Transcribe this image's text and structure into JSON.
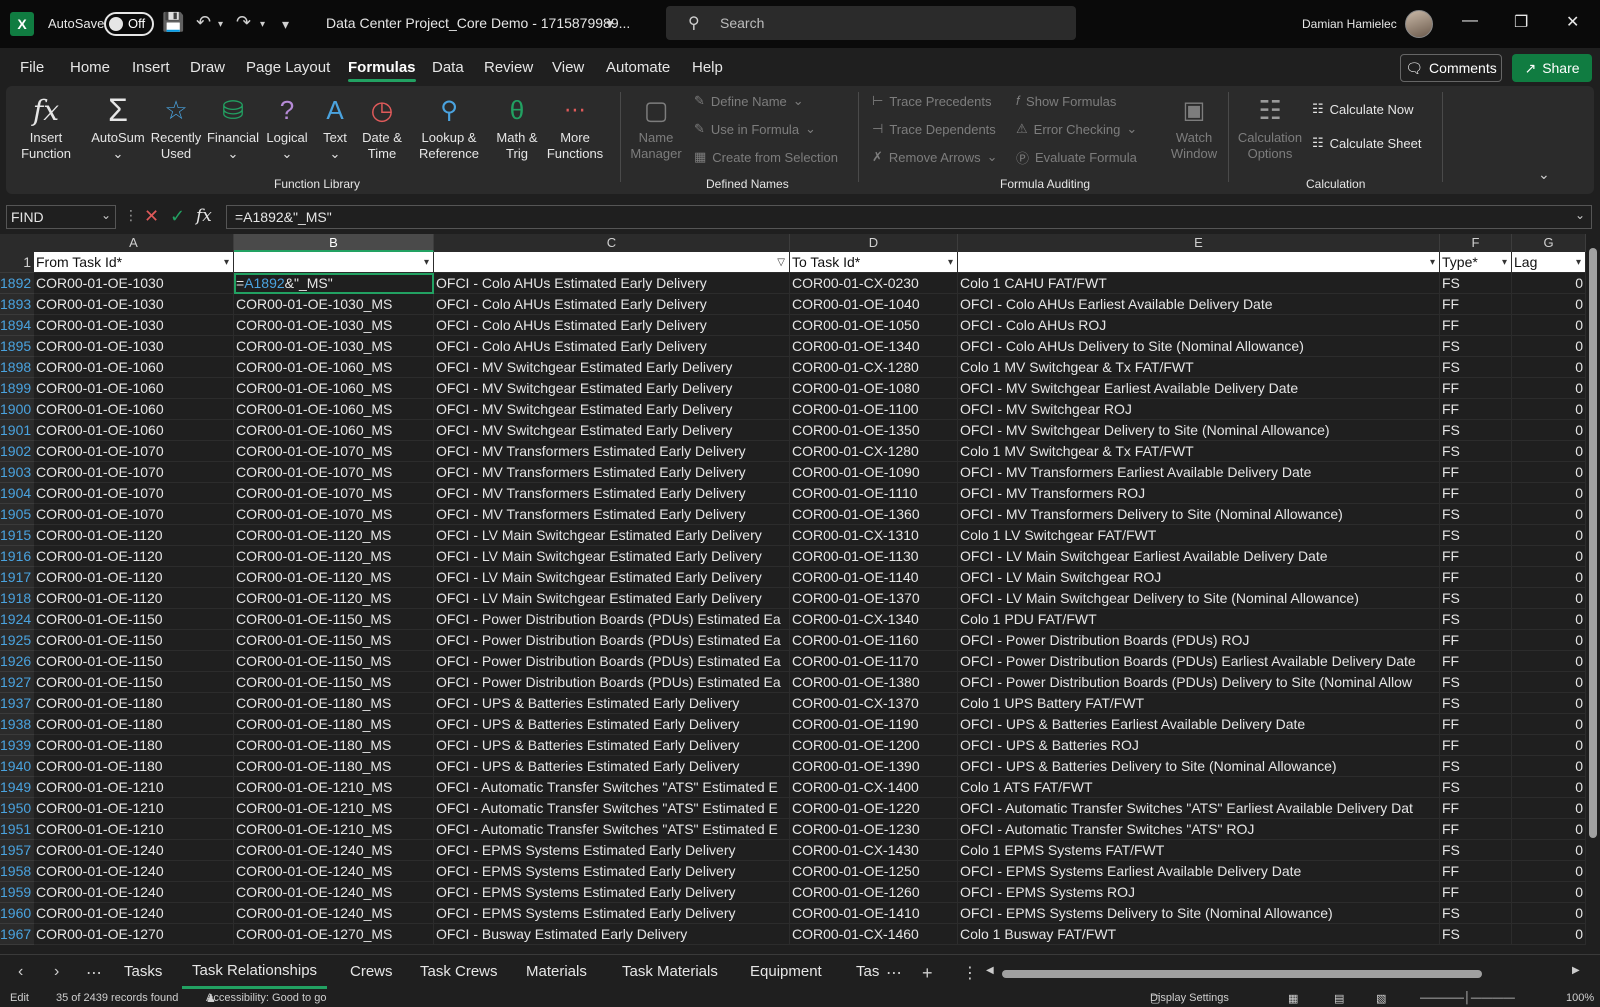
{
  "titlebar": {
    "autosave_label": "AutoSave",
    "autosave_state": "Off",
    "doc_title": "Data Center Project_Core Demo - 1715879989...",
    "search_placeholder": "Search",
    "user_name": "Damian Hamielec"
  },
  "menu": {
    "tabs": [
      "File",
      "Home",
      "Insert",
      "Draw",
      "Page Layout",
      "Formulas",
      "Data",
      "Review",
      "View",
      "Automate",
      "Help"
    ],
    "active": "Formulas",
    "comments": "Comments",
    "share": "Share"
  },
  "ribbon": {
    "insert_function": [
      "Insert",
      "Function"
    ],
    "autosum": "AutoSum",
    "recently_used": [
      "Recently",
      "Used"
    ],
    "financial": "Financial",
    "logical": "Logical",
    "text": "Text",
    "date_time": [
      "Date &",
      "Time"
    ],
    "lookup": [
      "Lookup &",
      "Reference"
    ],
    "math_trig": [
      "Math &",
      "Trig"
    ],
    "more_functions": [
      "More",
      "Functions"
    ],
    "function_library": "Function Library",
    "name_manager": [
      "Name",
      "Manager"
    ],
    "define_name": "Define Name",
    "use_in_formula": "Use in Formula",
    "create_from_selection": "Create from Selection",
    "defined_names": "Defined Names",
    "trace_precedents": "Trace Precedents",
    "trace_dependents": "Trace Dependents",
    "remove_arrows": "Remove Arrows",
    "show_formulas": "Show Formulas",
    "error_checking": "Error Checking",
    "evaluate_formula": "Evaluate Formula",
    "watch_window": [
      "Watch",
      "Window"
    ],
    "formula_auditing": "Formula Auditing",
    "calc_options": [
      "Calculation",
      "Options"
    ],
    "calculate_now": "Calculate Now",
    "calculate_sheet": "Calculate Sheet",
    "calculation": "Calculation"
  },
  "formula_bar": {
    "name_box": "FIND",
    "formula": "=A1892&\"_MS\"",
    "fx": "fx"
  },
  "grid": {
    "columns": [
      "A",
      "B",
      "C",
      "D",
      "E",
      "F",
      "G"
    ],
    "header_row_num": "1",
    "headers": [
      "From Task Id*",
      "",
      "",
      "To Task Id*",
      "",
      "Type*",
      "Lag"
    ],
    "active_cell_ref": "A1892",
    "active_cell_suffix": "&\"_MS\"",
    "rows": [
      [
        "1892",
        "COR00-01-OE-1030",
        "",
        "OFCI - Colo AHUs Estimated Early Delivery",
        "COR00-01-CX-0230",
        "Colo 1 CAHU FAT/FWT",
        "FS",
        "0"
      ],
      [
        "1893",
        "COR00-01-OE-1030",
        "COR00-01-OE-1030_MS",
        "OFCI - Colo AHUs Estimated Early Delivery",
        "COR00-01-OE-1040",
        "OFCI - Colo AHUs Earliest Available Delivery Date",
        "FF",
        "0"
      ],
      [
        "1894",
        "COR00-01-OE-1030",
        "COR00-01-OE-1030_MS",
        "OFCI - Colo AHUs Estimated Early Delivery",
        "COR00-01-OE-1050",
        "OFCI - Colo AHUs ROJ",
        "FF",
        "0"
      ],
      [
        "1895",
        "COR00-01-OE-1030",
        "COR00-01-OE-1030_MS",
        "OFCI - Colo AHUs Estimated Early Delivery",
        "COR00-01-OE-1340",
        "OFCI - Colo AHUs Delivery to Site (Nominal Allowance)",
        "FS",
        "0"
      ],
      [
        "1898",
        "COR00-01-OE-1060",
        "COR00-01-OE-1060_MS",
        "OFCI - MV Switchgear Estimated Early Delivery",
        "COR00-01-CX-1280",
        "Colo 1 MV Switchgear & Tx FAT/FWT",
        "FS",
        "0"
      ],
      [
        "1899",
        "COR00-01-OE-1060",
        "COR00-01-OE-1060_MS",
        "OFCI - MV Switchgear Estimated Early Delivery",
        "COR00-01-OE-1080",
        "OFCI - MV Switchgear Earliest Available Delivery Date",
        "FF",
        "0"
      ],
      [
        "1900",
        "COR00-01-OE-1060",
        "COR00-01-OE-1060_MS",
        "OFCI - MV Switchgear Estimated Early Delivery",
        "COR00-01-OE-1100",
        "OFCI - MV Switchgear ROJ",
        "FF",
        "0"
      ],
      [
        "1901",
        "COR00-01-OE-1060",
        "COR00-01-OE-1060_MS",
        "OFCI - MV Switchgear Estimated Early Delivery",
        "COR00-01-OE-1350",
        "OFCI - MV Switchgear Delivery to Site (Nominal Allowance)",
        "FS",
        "0"
      ],
      [
        "1902",
        "COR00-01-OE-1070",
        "COR00-01-OE-1070_MS",
        "OFCI - MV Transformers Estimated Early Delivery",
        "COR00-01-CX-1280",
        "Colo 1 MV Switchgear & Tx FAT/FWT",
        "FS",
        "0"
      ],
      [
        "1903",
        "COR00-01-OE-1070",
        "COR00-01-OE-1070_MS",
        "OFCI - MV Transformers Estimated Early Delivery",
        "COR00-01-OE-1090",
        "OFCI - MV Transformers Earliest Available Delivery Date",
        "FF",
        "0"
      ],
      [
        "1904",
        "COR00-01-OE-1070",
        "COR00-01-OE-1070_MS",
        "OFCI - MV Transformers Estimated Early Delivery",
        "COR00-01-OE-1110",
        "OFCI - MV Transformers ROJ",
        "FF",
        "0"
      ],
      [
        "1905",
        "COR00-01-OE-1070",
        "COR00-01-OE-1070_MS",
        "OFCI - MV Transformers Estimated Early Delivery",
        "COR00-01-OE-1360",
        "OFCI - MV Transformers Delivery to Site (Nominal Allowance)",
        "FS",
        "0"
      ],
      [
        "1915",
        "COR00-01-OE-1120",
        "COR00-01-OE-1120_MS",
        "OFCI - LV Main Switchgear Estimated Early Delivery",
        "COR00-01-CX-1310",
        "Colo 1 LV Switchgear FAT/FWT",
        "FS",
        "0"
      ],
      [
        "1916",
        "COR00-01-OE-1120",
        "COR00-01-OE-1120_MS",
        "OFCI - LV Main Switchgear Estimated Early Delivery",
        "COR00-01-OE-1130",
        "OFCI - LV Main Switchgear Earliest Available Delivery Date",
        "FF",
        "0"
      ],
      [
        "1917",
        "COR00-01-OE-1120",
        "COR00-01-OE-1120_MS",
        "OFCI - LV Main Switchgear Estimated Early Delivery",
        "COR00-01-OE-1140",
        "OFCI - LV Main Switchgear ROJ",
        "FF",
        "0"
      ],
      [
        "1918",
        "COR00-01-OE-1120",
        "COR00-01-OE-1120_MS",
        "OFCI - LV Main Switchgear Estimated Early Delivery",
        "COR00-01-OE-1370",
        "OFCI - LV Main Switchgear Delivery to Site (Nominal Allowance)",
        "FS",
        "0"
      ],
      [
        "1924",
        "COR00-01-OE-1150",
        "COR00-01-OE-1150_MS",
        "OFCI - Power Distribution Boards (PDUs) Estimated Ea",
        "COR00-01-CX-1340",
        "Colo 1 PDU FAT/FWT",
        "FS",
        "0"
      ],
      [
        "1925",
        "COR00-01-OE-1150",
        "COR00-01-OE-1150_MS",
        "OFCI - Power Distribution Boards (PDUs) Estimated Ea",
        "COR00-01-OE-1160",
        "OFCI - Power Distribution Boards (PDUs) ROJ",
        "FF",
        "0"
      ],
      [
        "1926",
        "COR00-01-OE-1150",
        "COR00-01-OE-1150_MS",
        "OFCI - Power Distribution Boards (PDUs) Estimated Ea",
        "COR00-01-OE-1170",
        "OFCI - Power Distribution Boards (PDUs) Earliest Available Delivery Date",
        "FF",
        "0"
      ],
      [
        "1927",
        "COR00-01-OE-1150",
        "COR00-01-OE-1150_MS",
        "OFCI - Power Distribution Boards (PDUs) Estimated Ea",
        "COR00-01-OE-1380",
        "OFCI - Power Distribution Boards (PDUs) Delivery to Site (Nominal Allow",
        "FS",
        "0"
      ],
      [
        "1937",
        "COR00-01-OE-1180",
        "COR00-01-OE-1180_MS",
        "OFCI - UPS & Batteries Estimated Early Delivery",
        "COR00-01-CX-1370",
        "Colo 1 UPS Battery FAT/FWT",
        "FS",
        "0"
      ],
      [
        "1938",
        "COR00-01-OE-1180",
        "COR00-01-OE-1180_MS",
        "OFCI - UPS & Batteries Estimated Early Delivery",
        "COR00-01-OE-1190",
        "OFCI - UPS & Batteries Earliest Available Delivery Date",
        "FF",
        "0"
      ],
      [
        "1939",
        "COR00-01-OE-1180",
        "COR00-01-OE-1180_MS",
        "OFCI - UPS & Batteries Estimated Early Delivery",
        "COR00-01-OE-1200",
        "OFCI - UPS & Batteries ROJ",
        "FF",
        "0"
      ],
      [
        "1940",
        "COR00-01-OE-1180",
        "COR00-01-OE-1180_MS",
        "OFCI - UPS & Batteries Estimated Early Delivery",
        "COR00-01-OE-1390",
        "OFCI - UPS & Batteries Delivery to Site (Nominal Allowance)",
        "FS",
        "0"
      ],
      [
        "1949",
        "COR00-01-OE-1210",
        "COR00-01-OE-1210_MS",
        "OFCI - Automatic Transfer Switches \"ATS\" Estimated E",
        "COR00-01-CX-1400",
        "Colo 1 ATS FAT/FWT",
        "FS",
        "0"
      ],
      [
        "1950",
        "COR00-01-OE-1210",
        "COR00-01-OE-1210_MS",
        "OFCI - Automatic Transfer Switches \"ATS\" Estimated E",
        "COR00-01-OE-1220",
        "OFCI - Automatic Transfer Switches \"ATS\" Earliest Available Delivery Dat",
        "FF",
        "0"
      ],
      [
        "1951",
        "COR00-01-OE-1210",
        "COR00-01-OE-1210_MS",
        "OFCI - Automatic Transfer Switches \"ATS\" Estimated E",
        "COR00-01-OE-1230",
        "OFCI - Automatic Transfer Switches \"ATS\" ROJ",
        "FF",
        "0"
      ],
      [
        "1957",
        "COR00-01-OE-1240",
        "COR00-01-OE-1240_MS",
        "OFCI - EPMS Systems Estimated Early Delivery",
        "COR00-01-CX-1430",
        "Colo 1 EPMS Systems FAT/FWT",
        "FS",
        "0"
      ],
      [
        "1958",
        "COR00-01-OE-1240",
        "COR00-01-OE-1240_MS",
        "OFCI - EPMS Systems Estimated Early Delivery",
        "COR00-01-OE-1250",
        "OFCI - EPMS Systems Earliest Available Delivery Date",
        "FF",
        "0"
      ],
      [
        "1959",
        "COR00-01-OE-1240",
        "COR00-01-OE-1240_MS",
        "OFCI - EPMS Systems Estimated Early Delivery",
        "COR00-01-OE-1260",
        "OFCI - EPMS Systems ROJ",
        "FF",
        "0"
      ],
      [
        "1960",
        "COR00-01-OE-1240",
        "COR00-01-OE-1240_MS",
        "OFCI - EPMS Systems Estimated Early Delivery",
        "COR00-01-OE-1410",
        "OFCI - EPMS Systems Delivery to Site (Nominal Allowance)",
        "FS",
        "0"
      ],
      [
        "1967",
        "COR00-01-OE-1270",
        "COR00-01-OE-1270_MS",
        "OFCI - Busway Estimated Early Delivery",
        "COR00-01-CX-1460",
        "Colo 1 Busway FAT/FWT",
        "FS",
        "0"
      ]
    ]
  },
  "sheets": {
    "tabs": [
      "Tasks",
      "Task Relationships",
      "Crews",
      "Task Crews",
      "Materials",
      "Task Materials",
      "Equipment",
      "Tas"
    ],
    "active": "Task Relationships"
  },
  "status": {
    "mode": "Edit",
    "records": "35 of 2439 records found",
    "accessibility": "Accessibility: Good to go",
    "display_settings": "Display Settings",
    "zoom": "100%"
  }
}
